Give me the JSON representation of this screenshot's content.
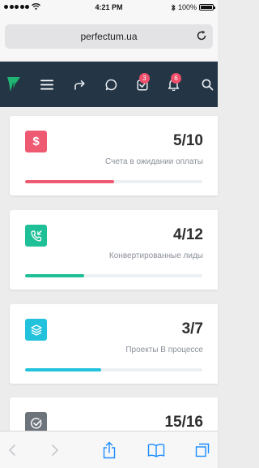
{
  "status_bar": {
    "time": "4:21 PM",
    "battery": "100%",
    "signal_dots": 5
  },
  "browser": {
    "url": "perfectum.ua"
  },
  "nav": {
    "logo_color": "#21b574",
    "tasks_badge": "3",
    "notifications_badge": "6"
  },
  "cards": [
    {
      "icon": "dollar-icon",
      "icon_color": "#ef5a73",
      "value": "5/10",
      "label": "Счета в ожидании оплаты",
      "progress": 0.5,
      "bar_color": "#ef5a73"
    },
    {
      "icon": "phone-incoming-icon",
      "icon_color": "#1fbf97",
      "value": "4/12",
      "label": "Конвертированные лиды",
      "progress": 0.333,
      "bar_color": "#1fbf97"
    },
    {
      "icon": "layers-icon",
      "icon_color": "#22c2dc",
      "value": "3/7",
      "label": "Проекты В процессе",
      "progress": 0.43,
      "bar_color": "#22c2dc"
    },
    {
      "icon": "check-circle-icon",
      "icon_color": "#6d747c",
      "value": "15/16",
      "label": "",
      "progress": 0.94,
      "bar_color": "#6d747c"
    }
  ]
}
